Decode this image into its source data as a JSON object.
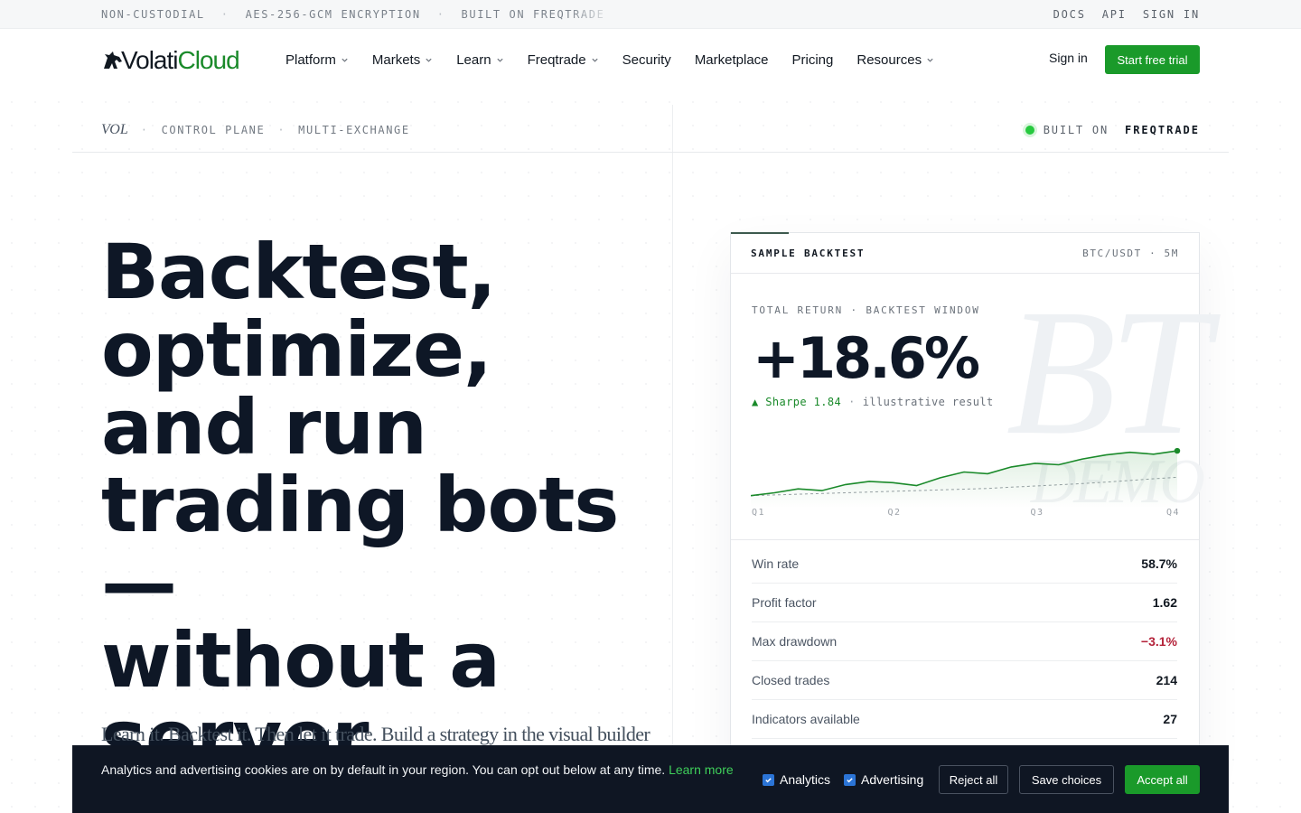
{
  "topstrip": {
    "left": [
      "NON-CUSTODIAL",
      "AES-256-GCM ENCRYPTION",
      "BUILT ON FREQTRADE"
    ],
    "separator": "·",
    "right": [
      "DOCS",
      "API",
      "SIGN IN"
    ]
  },
  "brand": {
    "name_a": "Volati",
    "name_b": "Cloud",
    "accent": "#1a9a2a"
  },
  "nav": {
    "items": [
      {
        "label": "Platform",
        "dropdown": true
      },
      {
        "label": "Markets",
        "dropdown": true
      },
      {
        "label": "Learn",
        "dropdown": true
      },
      {
        "label": "Freqtrade",
        "dropdown": true
      },
      {
        "label": "Security",
        "dropdown": false
      },
      {
        "label": "Marketplace",
        "dropdown": false
      },
      {
        "label": "Pricing",
        "dropdown": false
      },
      {
        "label": "Resources",
        "dropdown": true
      }
    ],
    "signin": "Sign in",
    "cta": "Start free trial"
  },
  "crumbs": {
    "tag": "VOL",
    "items": [
      "CONTROL PLANE",
      "MULTI-EXCHANGE"
    ],
    "separator": "·"
  },
  "status": {
    "label": "BUILT ON",
    "value": "FREQTRADE",
    "color": "#27c93f"
  },
  "hero": {
    "headline": [
      "Backtest,",
      "optimize,",
      "and run",
      "trading bots —",
      "without a",
      "server"
    ],
    "lede": "Learn it. Backtest it. Then let it trade. Build a strategy in the visual builder or in"
  },
  "card": {
    "title": "SAMPLE BACKTEST",
    "pair": "BTC/USDT · 5M",
    "watermark": "BT",
    "watermark2": "DEMO",
    "return_label": "TOTAL RETURN · BACKTEST WINDOW",
    "return_value": "+18.6%",
    "sharpe": "Sharpe 1.84",
    "sharpe_icon": "triangle-up-icon",
    "note": "illustrative result",
    "metrics": [
      {
        "label": "Win rate",
        "value": "58.7%",
        "negative": false
      },
      {
        "label": "Profit factor",
        "value": "1.62",
        "negative": false
      },
      {
        "label": "Max drawdown",
        "value": "−3.1%",
        "negative": true
      },
      {
        "label": "Closed trades",
        "value": "214",
        "negative": false
      },
      {
        "label": "Indicators available",
        "value": "27",
        "negative": false
      }
    ]
  },
  "chart_data": {
    "type": "line",
    "x_ticks": [
      "Q1",
      "Q2",
      "Q3",
      "Q4"
    ],
    "series": [
      {
        "values": [
          0.0,
          1.2,
          2.8,
          2.1,
          4.6,
          5.9,
          5.4,
          4.2,
          7.4,
          9.8,
          9.1,
          11.9,
          13.4,
          12.8,
          15.2,
          16.9,
          18.0,
          17.2,
          18.6
        ],
        "color": "#1a8a2a"
      },
      {
        "values": [
          0.0,
          0.3,
          0.6,
          0.9,
          1.2,
          1.5,
          1.8,
          2.1,
          2.4,
          2.7,
          3.0,
          3.5,
          4.0,
          4.5,
          5.0,
          5.6,
          6.3,
          7.0,
          7.6
        ],
        "color": "#9aa0a7",
        "dashed": true
      }
    ],
    "ylim": [
      -2,
      22
    ]
  },
  "cookie": {
    "message": "Analytics and advertising cookies are on by default in your region. You can opt out below at any time.",
    "link": "Learn more",
    "options": [
      {
        "label": "Analytics",
        "checked": true
      },
      {
        "label": "Advertising",
        "checked": true
      }
    ],
    "reject": "Reject all",
    "save": "Save choices",
    "accept": "Accept all"
  }
}
